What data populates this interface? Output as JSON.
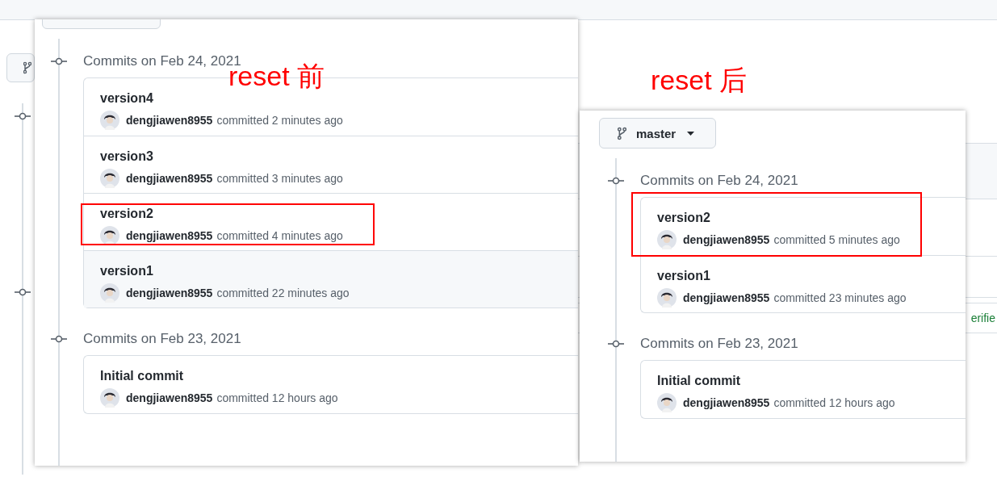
{
  "background_page": {
    "verified_label": "erifie"
  },
  "panels": [
    {
      "annotation": "reset 前",
      "groups": [
        {
          "header": "Commits on Feb 24, 2021",
          "commits": [
            {
              "title": "version4",
              "author": "dengjiawen8955",
              "action": "committed",
              "time": "2 minutes ago",
              "marked": false,
              "hovered": false
            },
            {
              "title": "version3",
              "author": "dengjiawen8955",
              "action": "committed",
              "time": "3 minutes ago",
              "marked": false,
              "hovered": false
            },
            {
              "title": "version2",
              "author": "dengjiawen8955",
              "action": "committed",
              "time": "4 minutes ago",
              "marked": true,
              "hovered": false
            },
            {
              "title": "version1",
              "author": "dengjiawen8955",
              "action": "committed",
              "time": "22 minutes ago",
              "marked": false,
              "hovered": true
            }
          ]
        },
        {
          "header": "Commits on Feb 23, 2021",
          "commits": [
            {
              "title": "Initial commit",
              "author": "dengjiawen8955",
              "action": "committed",
              "time": "12 hours ago",
              "marked": false,
              "hovered": false
            }
          ]
        }
      ]
    },
    {
      "annotation": "reset 后",
      "branch": "master",
      "groups": [
        {
          "header": "Commits on Feb 24, 2021",
          "commits": [
            {
              "title": "version2",
              "author": "dengjiawen8955",
              "action": "committed",
              "time": "5 minutes ago",
              "marked": true,
              "hovered": false
            },
            {
              "title": "version1",
              "author": "dengjiawen8955",
              "action": "committed",
              "time": "23 minutes ago",
              "marked": false,
              "hovered": false
            }
          ]
        },
        {
          "header": "Commits on Feb 23, 2021",
          "commits": [
            {
              "title": "Initial commit",
              "author": "dengjiawen8955",
              "action": "committed",
              "time": "12 hours ago",
              "marked": false,
              "hovered": false
            }
          ]
        }
      ]
    }
  ]
}
